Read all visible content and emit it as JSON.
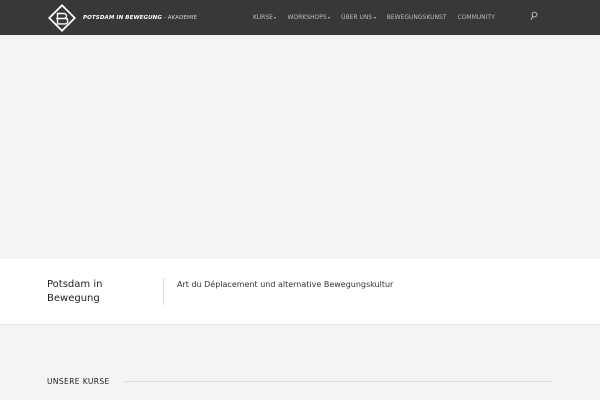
{
  "header": {
    "brand_bold": "POTSDAM IN BEWEGUNG",
    "brand_light": " - AKADEMIE",
    "logo_icon": "pib-diamond-logo",
    "search_icon": "search-icon"
  },
  "nav": {
    "items": [
      {
        "label": "KURSE",
        "dropdown": true
      },
      {
        "label": "WORKSHOPS",
        "dropdown": true
      },
      {
        "label": "ÜBER UNS",
        "dropdown": true
      },
      {
        "label": "BEWEGUNGSKUNST",
        "dropdown": false
      },
      {
        "label": "COMMUNITY",
        "dropdown": false
      }
    ]
  },
  "intro": {
    "title": "Potsdam in Bewegung",
    "tagline": "Art du Déplacement und alternative Bewegungskultur"
  },
  "section": {
    "title": "UNSERE KURSE"
  },
  "colors": {
    "navbar": "#383838",
    "background": "#f4f4f4"
  }
}
